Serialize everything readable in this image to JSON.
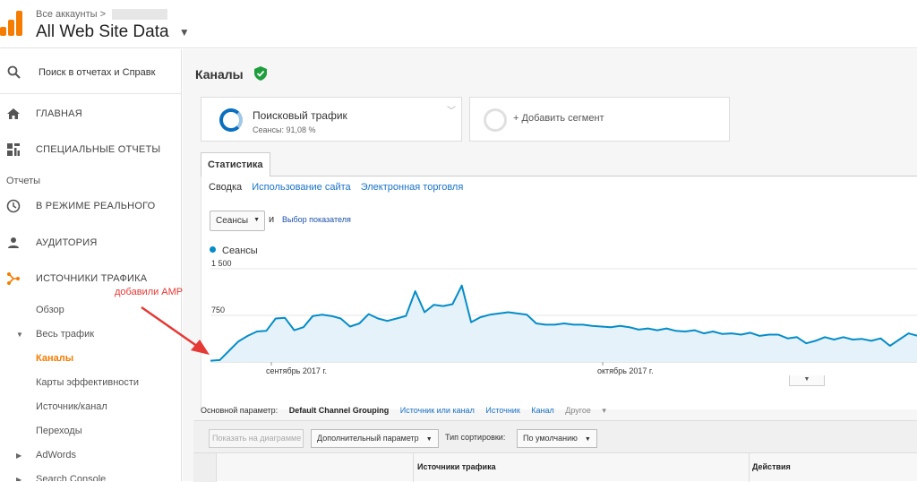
{
  "header": {
    "breadcrumb": "Все аккаунты",
    "breadcrumb_sep": ">",
    "property": "All Web Site Data",
    "brand_color": "#f57c00"
  },
  "sidebar": {
    "search_label": "Поиск в отчетах и Справк",
    "nav": [
      {
        "label": "ГЛАВНАЯ",
        "icon": "home-icon"
      },
      {
        "label": "СПЕЦИАЛЬНЫЕ ОТЧЕТЫ",
        "icon": "custom-reports-icon"
      }
    ],
    "reports_label": "Отчеты",
    "reports": [
      {
        "label": "В РЕЖИМЕ РЕАЛЬНОГО",
        "icon": "clock-icon"
      },
      {
        "label": "АУДИТОРИЯ",
        "icon": "person-icon"
      },
      {
        "label": "ИСТОЧНИКИ ТРАФИКА",
        "icon": "acquisition-icon"
      }
    ],
    "sub": {
      "overview": "Обзор",
      "all_traffic": "Весь трафик",
      "channels": "Каналы",
      "treemaps": "Карты эффективности",
      "source_medium": "Источник/канал",
      "referrals": "Переходы",
      "adwords": "AdWords",
      "search_console": "Search Console"
    }
  },
  "main": {
    "title": "Каналы",
    "segments": {
      "active_name": "Поисковый трафик",
      "active_share": "Сеансы: 91,08 %",
      "add_label": "+ Добавить сегмент"
    },
    "tab": "Статистика",
    "subtabs": {
      "summary": "Сводка",
      "site_usage": "Использование сайта",
      "ecommerce": "Электронная торговля"
    },
    "metric_select": "Сеансы",
    "conj": "и",
    "metric_link": "Выбор показателя"
  },
  "annotation": {
    "text": "добавили AMP",
    "color": "#e53935"
  },
  "dimensions": {
    "label": "Основной параметр:",
    "current": "Default Channel Grouping",
    "links": [
      "Источник или канал",
      "Источник",
      "Канал"
    ],
    "other": "Другое"
  },
  "toolbar": {
    "plot_rows": "Показать на диаграмме",
    "secondary": "Дополнительный параметр",
    "sort_label": "Тип сортировки:",
    "sort_value": "По умолчанию"
  },
  "table": {
    "header": "Источники трафика",
    "actions": "Действия"
  },
  "chart_data": {
    "type": "area",
    "series": [
      {
        "name": "Сеансы",
        "color": "#058dc7",
        "values": [
          20,
          30,
          180,
          330,
          420,
          490,
          500,
          700,
          710,
          510,
          560,
          740,
          760,
          740,
          700,
          570,
          620,
          770,
          700,
          660,
          700,
          740,
          1140,
          800,
          920,
          900,
          930,
          1230,
          640,
          720,
          760,
          780,
          800,
          780,
          760,
          620,
          600,
          600,
          620,
          600,
          600,
          580,
          570,
          560,
          580,
          560,
          520,
          540,
          510,
          540,
          500,
          490,
          510,
          460,
          490,
          450,
          460,
          440,
          470,
          420,
          440,
          440,
          380,
          400,
          300,
          340,
          400,
          360,
          400,
          360,
          370,
          340,
          380,
          260,
          360,
          460,
          420
        ]
      }
    ],
    "y_ticks": [
      "1 500",
      "750"
    ],
    "x_ticks": [
      "сентябрь 2017 г.",
      "октябрь 2017 г."
    ],
    "ylim": [
      0,
      1500
    ],
    "grid": true
  }
}
